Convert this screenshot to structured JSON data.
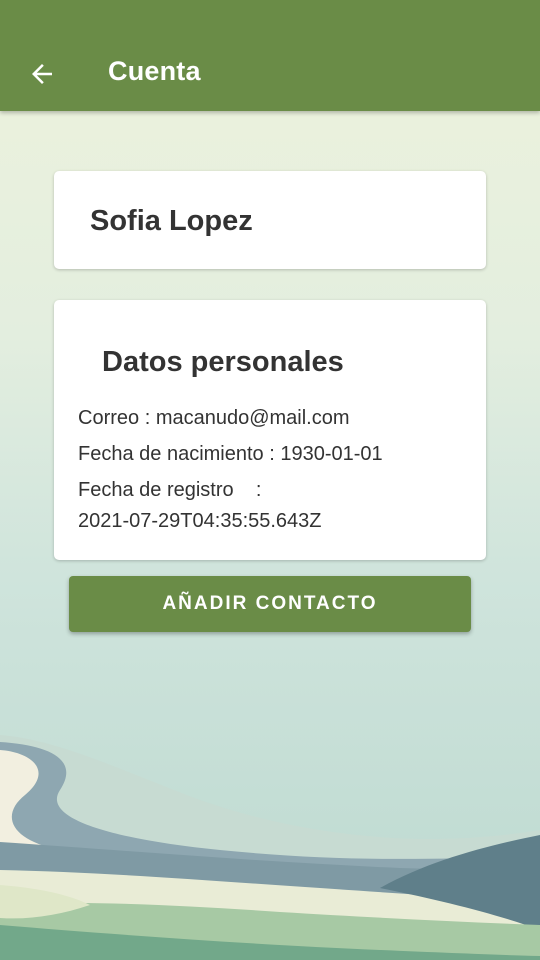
{
  "appbar": {
    "title": "Cuenta",
    "back_icon": "arrow-left-icon",
    "color": "#6a8c47"
  },
  "profile": {
    "name": "Sofia Lopez"
  },
  "personal_data": {
    "title": "Datos personales",
    "email_label": "Correo :",
    "email_value": "macanudo@mail.com",
    "birth_label": "Fecha de nacimiento :",
    "birth_value": "1930-01-01",
    "registered_label": "Fecha de registro",
    "registered_sep": ":",
    "registered_value": "2021-07-29T04:35:55.643Z"
  },
  "actions": {
    "add_contact_label": "AÑADIR CONTACTO"
  }
}
